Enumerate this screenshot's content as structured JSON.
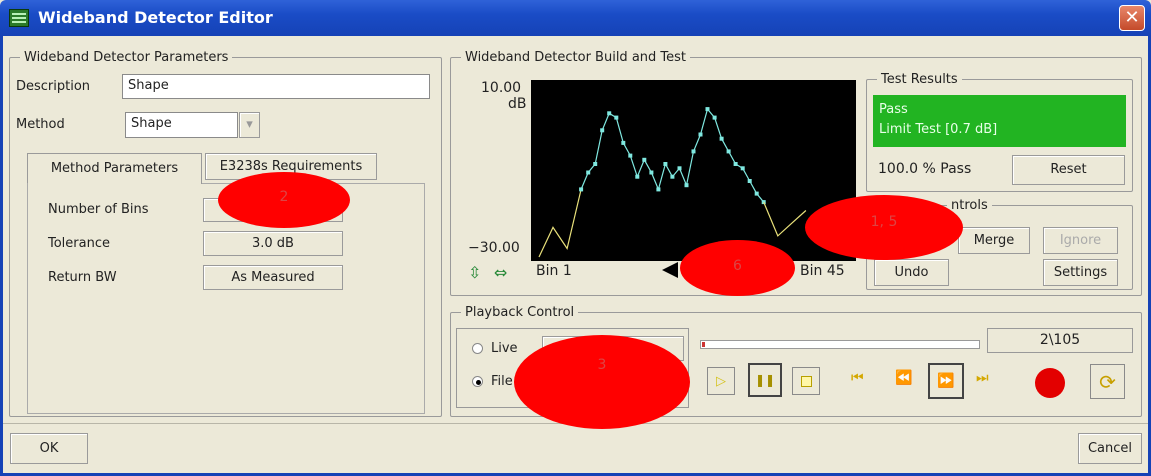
{
  "window": {
    "title": "Wideband Detector Editor",
    "close": "✕"
  },
  "params": {
    "legend": "Wideband Detector Parameters",
    "description_label": "Description",
    "description_value": "Shape",
    "method_label": "Method",
    "method_value": "Shape",
    "tabs": [
      "Method Parameters",
      "E3238s Requirements"
    ],
    "rows": [
      {
        "label": "Number of Bins",
        "value": ""
      },
      {
        "label": "Tolerance",
        "value": "3.0 dB"
      },
      {
        "label": "Return BW",
        "value": "As Measured"
      }
    ]
  },
  "build": {
    "legend": "Wideband Detector Build and Test",
    "y_top": "10.00",
    "y_unit": "dB",
    "y_bottom": "−30.00",
    "x_left": "Bin 1",
    "x_right": "Bin 45"
  },
  "test_results": {
    "legend": "Test Results",
    "status": "Pass",
    "detail": "Limit Test [0.7 dB]",
    "percent": "100.0 % Pass",
    "reset": "Reset"
  },
  "controls": {
    "legend": "ntrols",
    "merge": "Merge",
    "ignore": "Ignore",
    "undo": "Undo",
    "settings": "Settings"
  },
  "playback": {
    "legend": "Playback Control",
    "live": "Live",
    "file": "File",
    "position": "2\\105"
  },
  "bottom": {
    "ok": "OK",
    "cancel": "Cancel"
  },
  "annotations": [
    "2",
    "1, 5",
    "6",
    "3"
  ],
  "colors": {
    "pass_green": "#22b422",
    "trace_yellow": "#e8e07a",
    "trace_cyan": "#7fe8e0",
    "highlight_red": "#ff0000"
  },
  "chart_data": {
    "type": "line",
    "ylim": [
      -30,
      10
    ],
    "x_range": [
      1,
      45
    ],
    "series": [
      {
        "points": [
          [
            1,
            -30
          ],
          [
            3,
            -23
          ],
          [
            5,
            -28
          ],
          [
            6,
            -21
          ],
          [
            7,
            -14
          ]
        ]
      },
      {
        "points": [
          [
            7,
            -14
          ],
          [
            8,
            -10
          ],
          [
            9,
            -8
          ],
          [
            10,
            0
          ],
          [
            11,
            4
          ],
          [
            12,
            3
          ],
          [
            13,
            -3
          ],
          [
            14,
            -6
          ],
          [
            15,
            -11
          ],
          [
            16,
            -7
          ],
          [
            17,
            -10
          ],
          [
            18,
            -14
          ],
          [
            19,
            -8
          ],
          [
            20,
            -11
          ],
          [
            21,
            -9
          ],
          [
            22,
            -13
          ],
          [
            23,
            -5
          ],
          [
            24,
            -1
          ],
          [
            25,
            5
          ],
          [
            26,
            3
          ],
          [
            27,
            -2
          ],
          [
            28,
            -5
          ],
          [
            29,
            -8
          ],
          [
            30,
            -9
          ],
          [
            31,
            -12
          ],
          [
            32,
            -15
          ],
          [
            33,
            -17
          ]
        ]
      },
      {
        "points": [
          [
            33,
            -17
          ],
          [
            35,
            -25
          ],
          [
            37,
            -22
          ],
          [
            39,
            -19
          ]
        ]
      }
    ]
  }
}
